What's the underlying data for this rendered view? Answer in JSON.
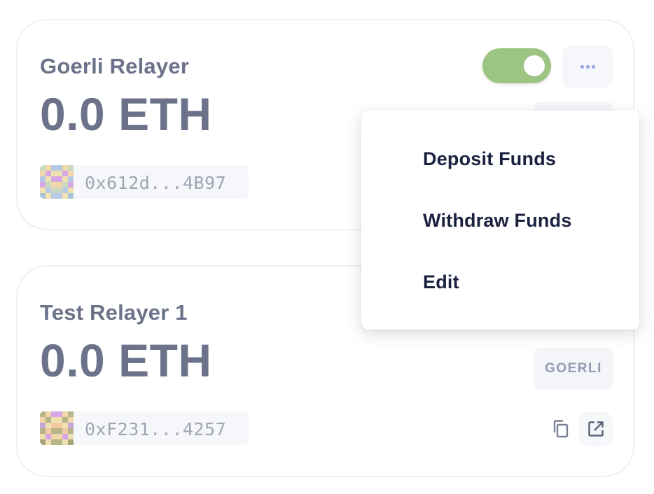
{
  "relayers": [
    {
      "name": "Goerli Relayer",
      "balance": "0.0 ETH",
      "address": "0x612d...4B97",
      "enabled": true
    },
    {
      "name": "Test Relayer 1",
      "balance": "0.0 ETH",
      "address": "0xF231...4257",
      "network": "GOERLI"
    }
  ],
  "menu": {
    "items": [
      "Deposit Funds",
      "Withdraw Funds",
      "Edit"
    ]
  },
  "colors": {
    "text_muted": "#6b7289",
    "toggle_on": "#9cc483",
    "menu_text": "#1b2240",
    "address_text": "#a0a5b4"
  },
  "icons": {
    "more": "more-horizontal-icon",
    "copy": "copy-icon",
    "external": "external-link-icon"
  }
}
